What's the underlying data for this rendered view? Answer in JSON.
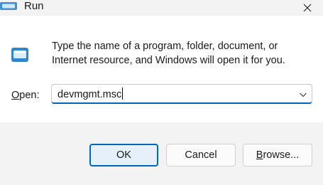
{
  "window": {
    "title": "Run",
    "close_icon": "close-icon",
    "app_icon": "run-icon"
  },
  "dialog": {
    "description_line1": "Type the name of a program, folder, document, or",
    "description_line2": "Internet resource, and Windows will open it for you.",
    "open_label_mnemonic": "O",
    "open_label_rest": "pen:",
    "open_value": "devmgmt.msc"
  },
  "buttons": {
    "ok": "OK",
    "cancel": "Cancel",
    "browse_mnemonic": "B",
    "browse_rest": "rowse..."
  },
  "colors": {
    "accent": "#0067c0",
    "background": "#f3f3f3",
    "content": "#ffffff"
  }
}
